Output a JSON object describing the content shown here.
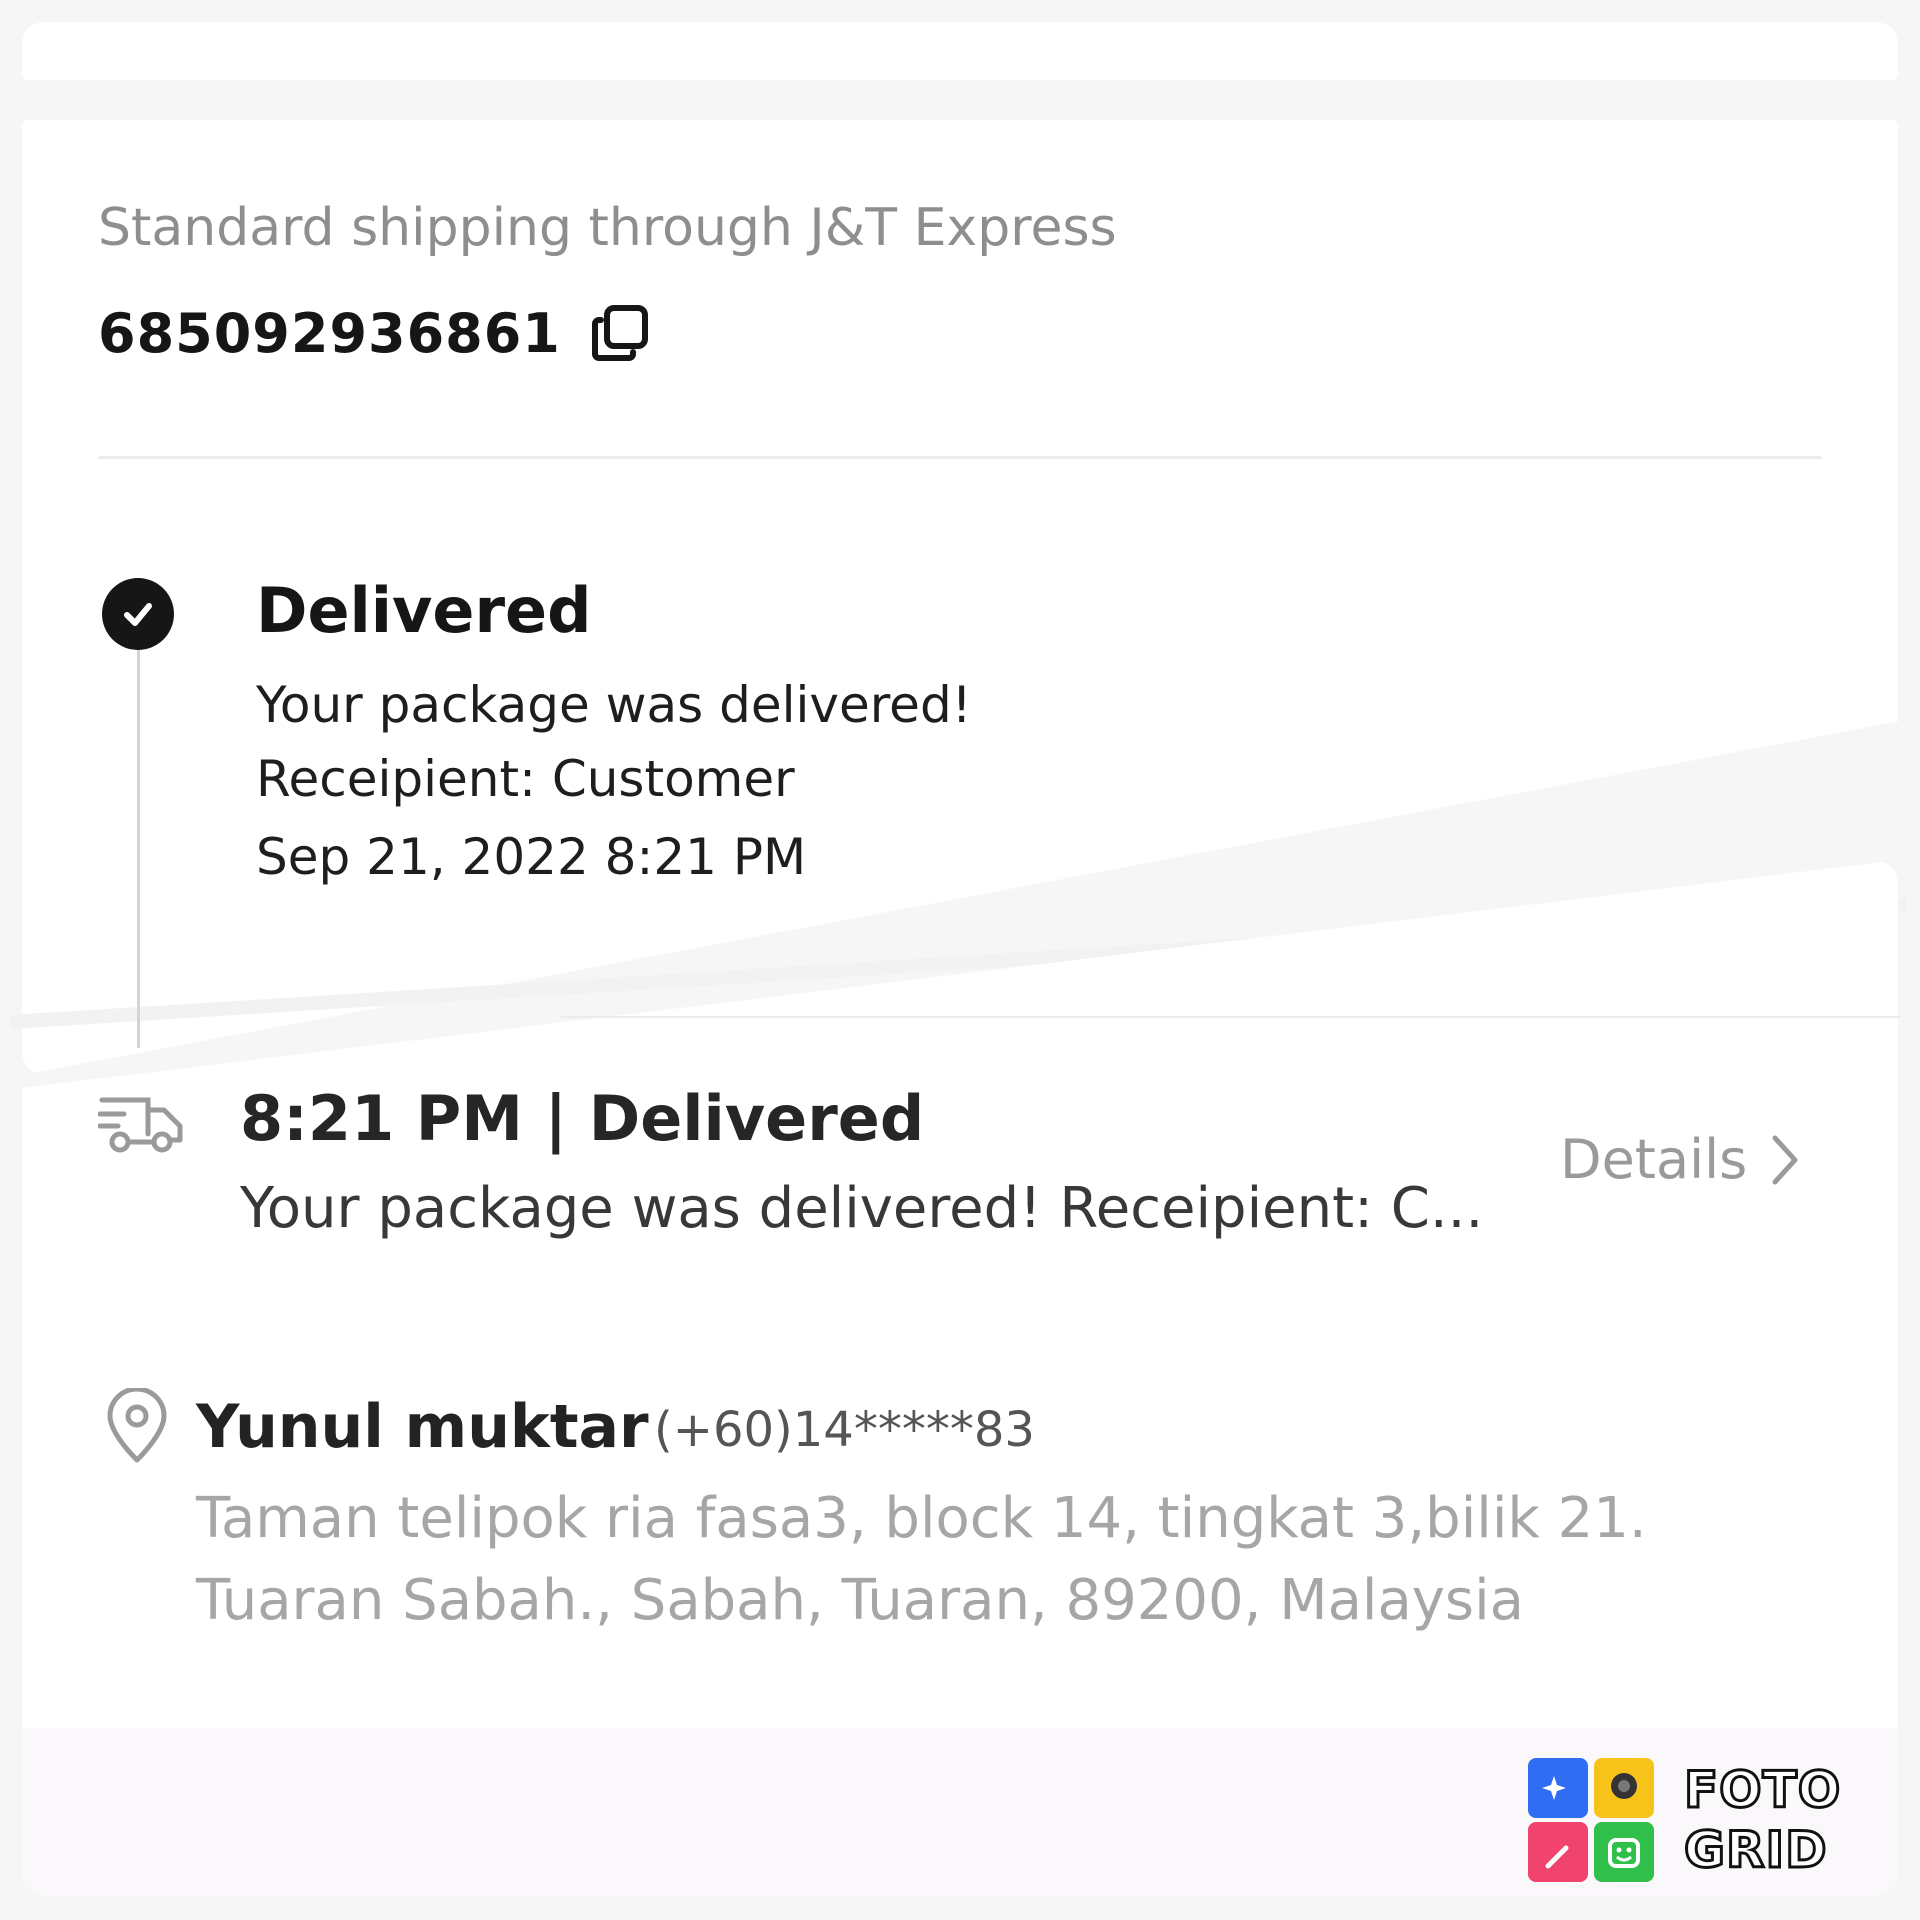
{
  "shipping": {
    "carrier_text": "Standard shipping through J&T Express",
    "tracking_number": "685092936861"
  },
  "latest_status": {
    "title": "Delivered",
    "lines": [
      "Your package was delivered!",
      "Receipient: Customer",
      "Sep 21, 2022 8:21 PM"
    ]
  },
  "tracking_event": {
    "title": "8:21 PM | Delivered",
    "summary": "Your package was delivered! Receipient: C...",
    "details_label": "Details"
  },
  "recipient": {
    "name": "Yunul muktar",
    "phone": "(+60)14*****83",
    "address_lines": [
      "Taman telipok ria fasa3, block 14, tingkat 3,bilik 21.",
      "Tuaran Sabah., Sabah, Tuaran, 89200, Malaysia"
    ]
  },
  "watermark": {
    "line1": "FOTO",
    "line2": "GRID"
  },
  "icons": {
    "copy": "copy-icon",
    "status": "check-circle-icon",
    "event": "delivery-truck-icon",
    "details": "chevron-right-icon",
    "address": "location-pin-icon"
  },
  "colors": {
    "primary_text": "#161616",
    "muted_text": "#8e8e8e",
    "address_text": "#a6a6a6",
    "background": "#f6f6f6",
    "card": "#ffffff"
  }
}
